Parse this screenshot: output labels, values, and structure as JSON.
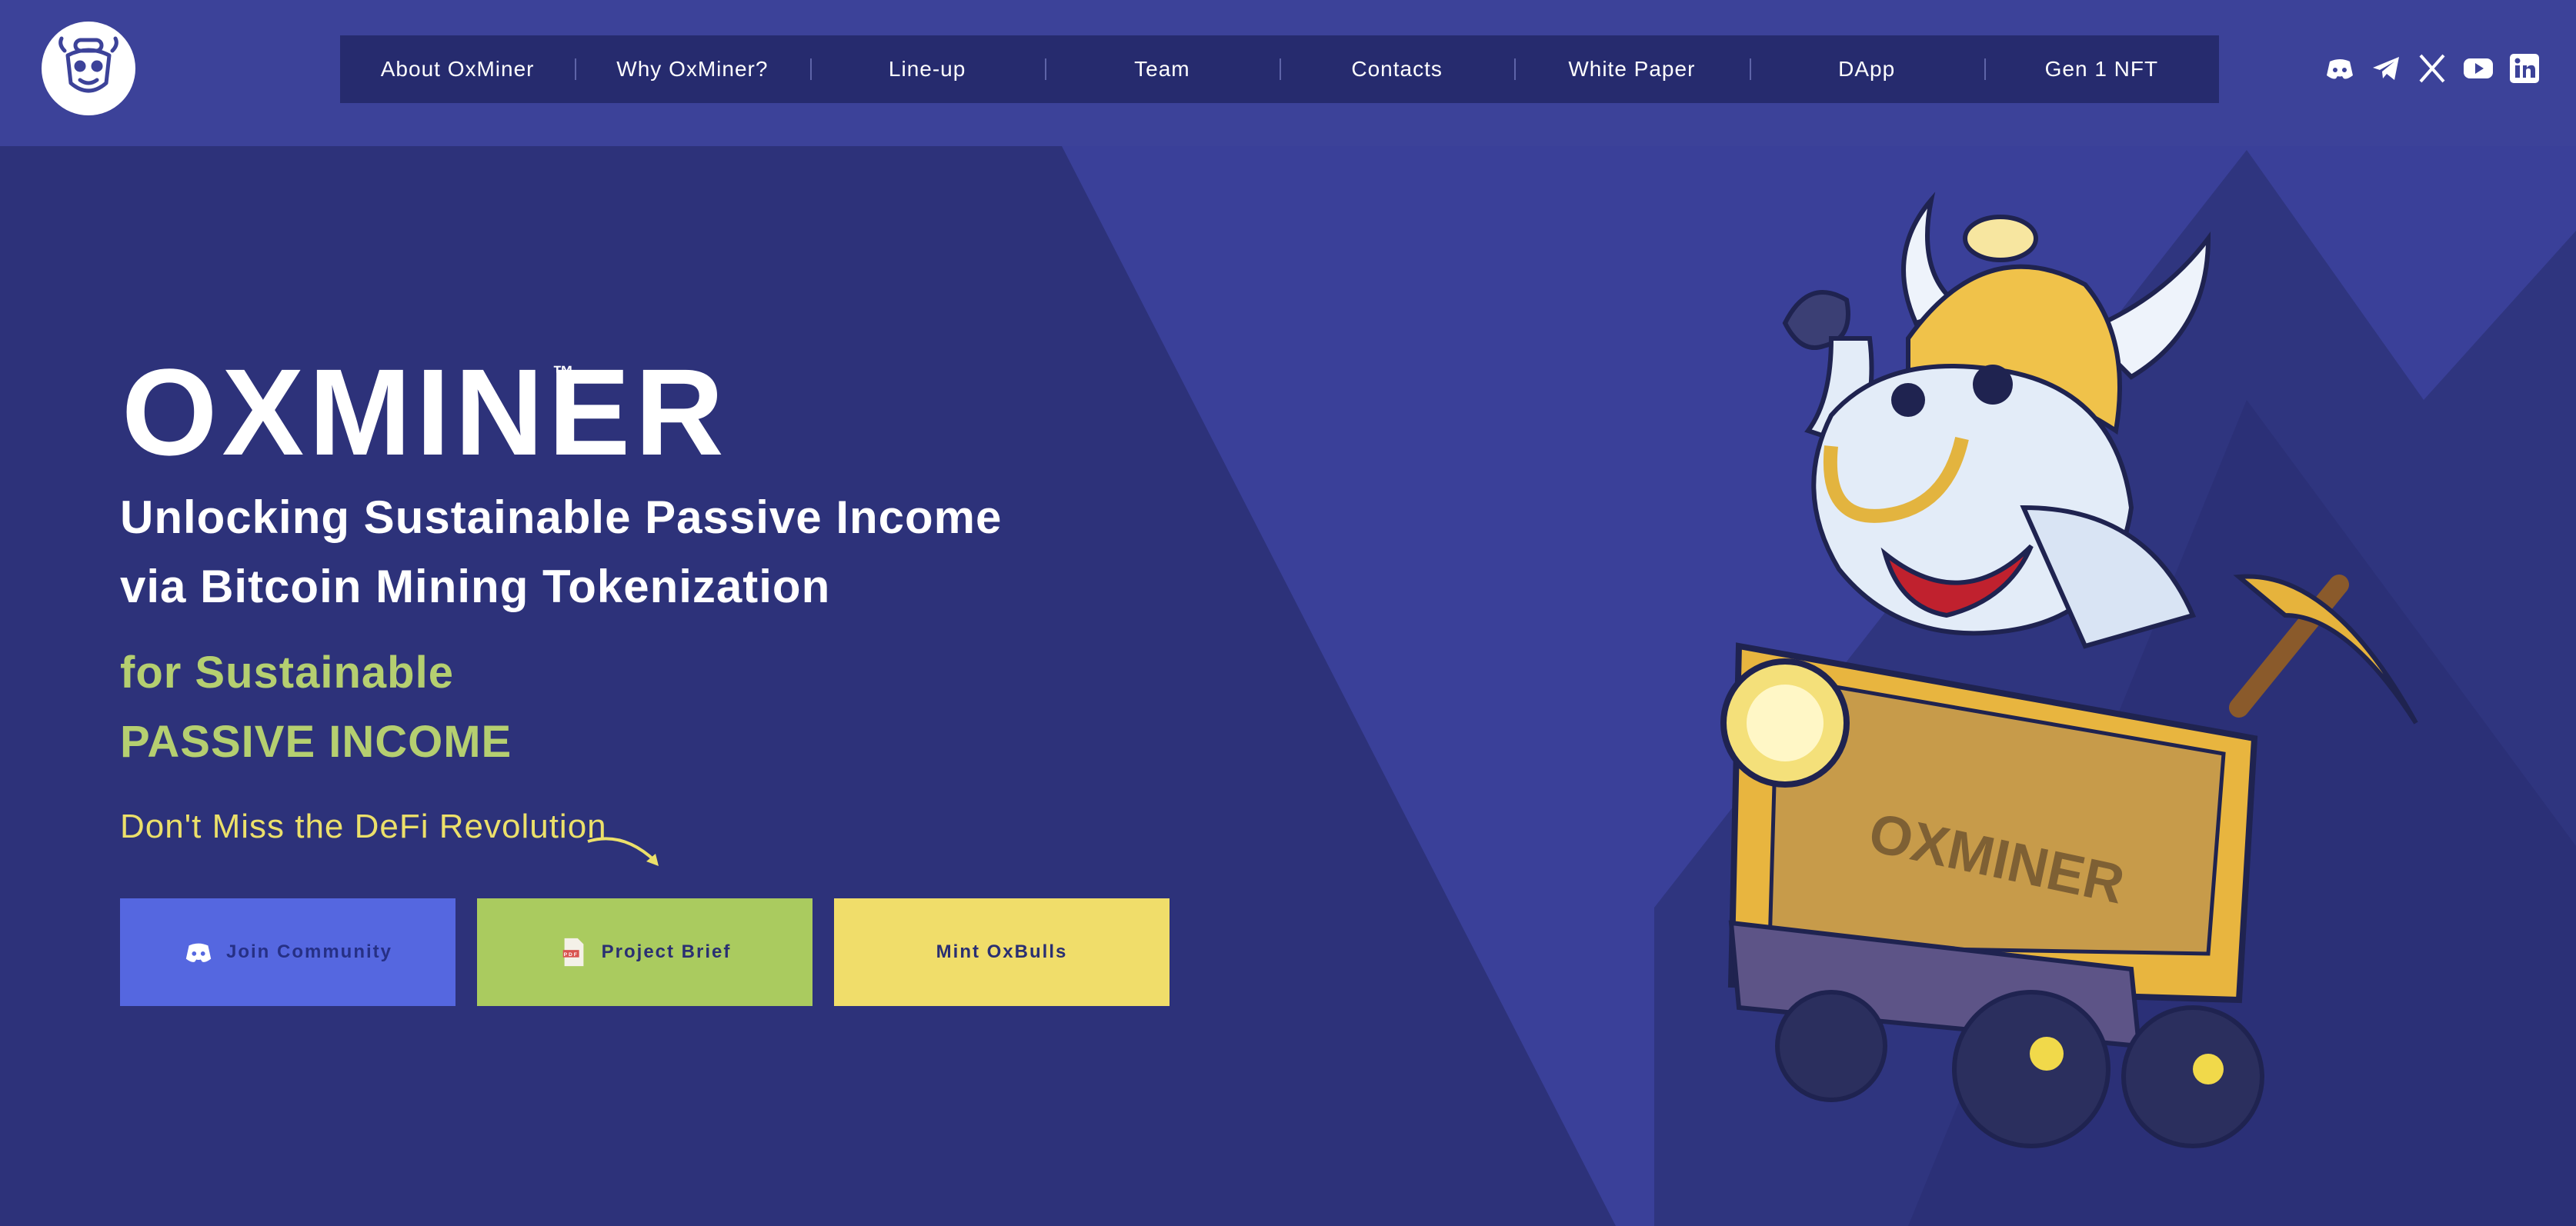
{
  "header": {
    "logo_icon": "ox-bull-logo-icon",
    "nav": [
      {
        "label": "About OxMiner"
      },
      {
        "label": "Why OxMiner?"
      },
      {
        "label": "Line-up"
      },
      {
        "label": "Team"
      },
      {
        "label": "Contacts"
      },
      {
        "label": "White Paper"
      },
      {
        "label": "DApp"
      },
      {
        "label": "Gen 1 NFT"
      }
    ],
    "socials": [
      "discord-icon",
      "telegram-icon",
      "x-icon",
      "youtube-icon",
      "linkedin-icon"
    ]
  },
  "hero": {
    "brand": "OXMINER",
    "trademark": "™",
    "headline_line1": "Unlocking Sustainable Passive Income",
    "headline_line2": "via Bitcoin Mining Tokenization",
    "sub_line1": "for Sustainable",
    "sub_line2": "PASSIVE INCOME",
    "tagline": "Don't Miss the DeFi Revolution",
    "buttons": {
      "join": "Join Community",
      "brief": "Project Brief",
      "mint": "Mint OxBulls"
    },
    "mascot_cart_text": "OXMINER"
  },
  "colors": {
    "background": "#2d327a",
    "header_bg": "#3c4299",
    "accent_green": "#b5cf70",
    "accent_yellow": "#ece06a",
    "button_blue": "#5567e0",
    "button_green": "#aacb5f",
    "button_yellow": "#f0dd6a"
  }
}
